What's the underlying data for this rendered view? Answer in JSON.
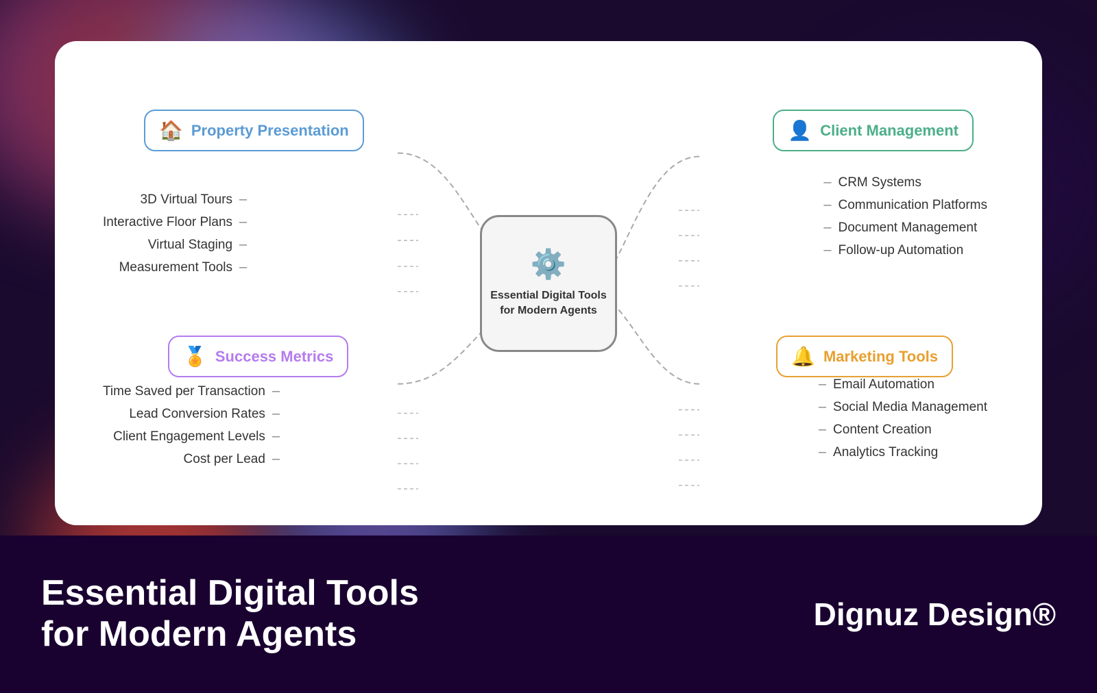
{
  "background": {
    "color": "#1a0a2e"
  },
  "bottom_bar": {
    "title": "Essential Digital Tools for Modern Agents",
    "brand": "Dignuz Design®"
  },
  "center_node": {
    "label": "Essential Digital Tools for Modern Agents",
    "icon": "⚙️"
  },
  "categories": {
    "property_presentation": {
      "label": "Property Presentation",
      "icon": "🏠",
      "color": "#5b9bd5"
    },
    "success_metrics": {
      "label": "Success Metrics",
      "icon": "🏅",
      "color": "#b57bee"
    },
    "client_management": {
      "label": "Client Management",
      "icon": "👤",
      "color": "#4caf87"
    },
    "marketing_tools": {
      "label": "Marketing Tools",
      "icon": "🔔",
      "color": "#e8a030"
    }
  },
  "items": {
    "property": [
      "3D Virtual Tours",
      "Interactive Floor Plans",
      "Virtual Staging",
      "Measurement Tools"
    ],
    "success": [
      "Time Saved per Transaction",
      "Lead Conversion Rates",
      "Client Engagement Levels",
      "Cost per Lead"
    ],
    "client": [
      "CRM Systems",
      "Communication Platforms",
      "Document Management",
      "Follow-up Automation"
    ],
    "marketing": [
      "Email Automation",
      "Social Media Management",
      "Content Creation",
      "Analytics Tracking"
    ]
  }
}
